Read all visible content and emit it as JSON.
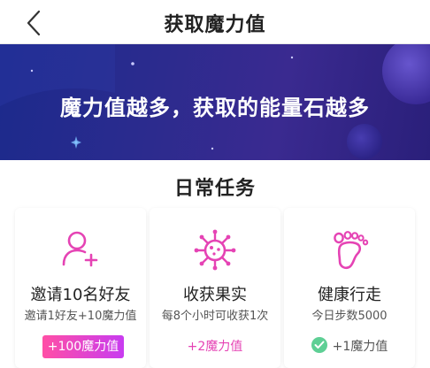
{
  "header": {
    "title": "获取魔力值"
  },
  "banner": {
    "slogan": "魔力值越多，获取的能量石越多"
  },
  "daily": {
    "title": "日常任务",
    "tasks": [
      {
        "name": "邀请10名好友",
        "desc": "邀请1好友+10魔力值",
        "reward": "+100魔力值",
        "icon": "add-user-icon",
        "state": "button"
      },
      {
        "name": "收获果实",
        "desc": "每8个小时可收获1次",
        "reward": "+2魔力值",
        "icon": "fruit-icon",
        "state": "available"
      },
      {
        "name": "健康行走",
        "desc": "今日步数5000",
        "reward": "+1魔力值",
        "icon": "footprint-icon",
        "state": "completed"
      }
    ]
  },
  "colors": {
    "accent": "#e543b4",
    "banner": "#2b2b8e",
    "done": "#5ecf95"
  }
}
